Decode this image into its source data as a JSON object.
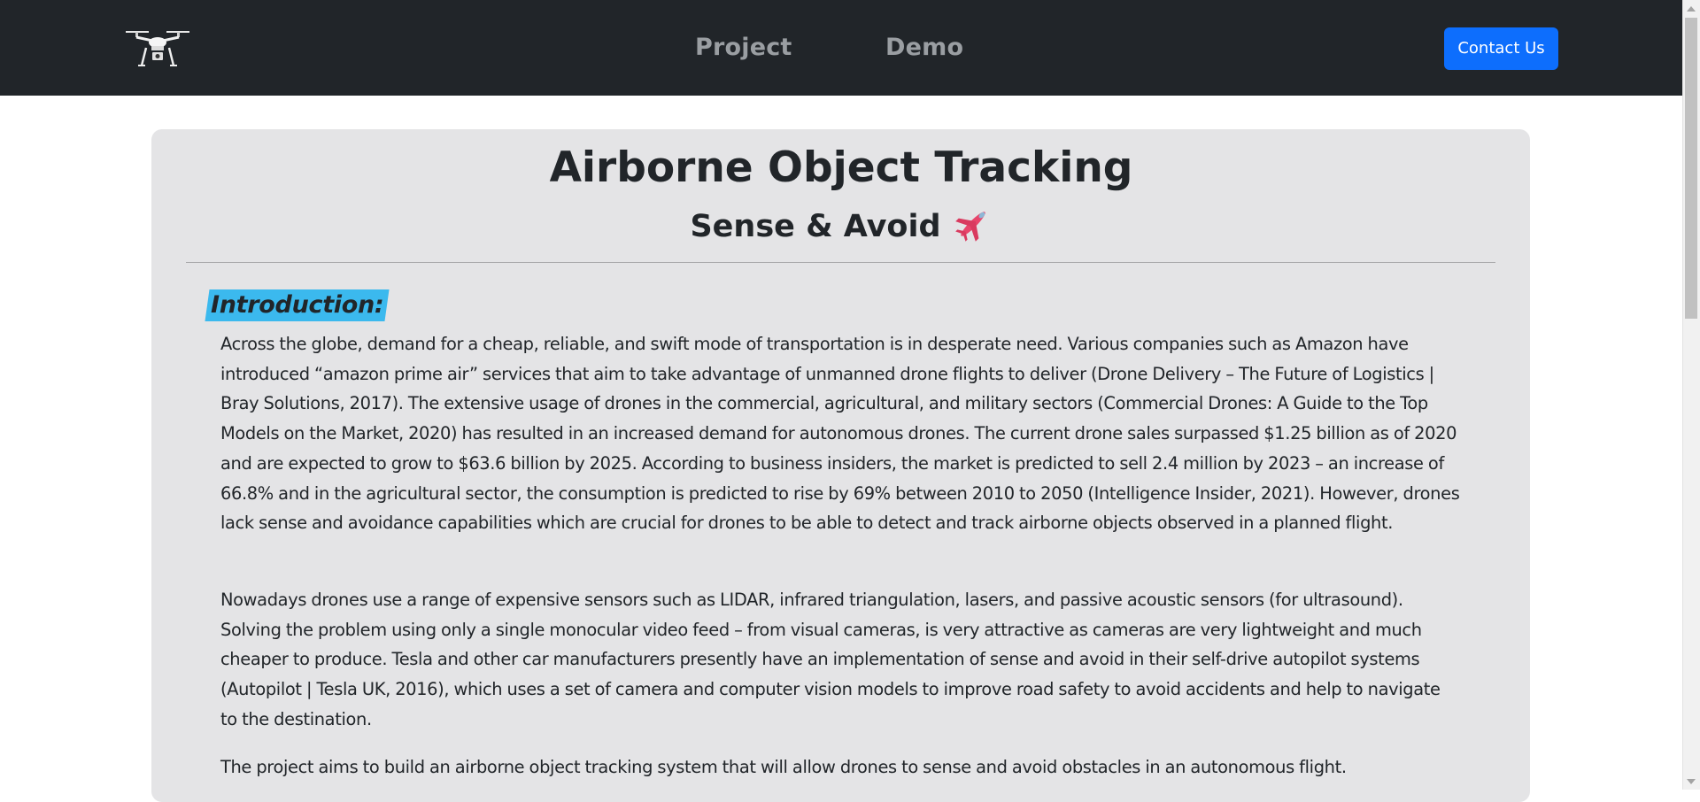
{
  "nav": {
    "logo_icon": "drone-icon",
    "links": [
      "Project",
      "Demo"
    ],
    "contact_label": "Contact Us",
    "contact_color": "#0d6efd",
    "bar_color": "#212529"
  },
  "header": {
    "title": "Airborne Object Tracking",
    "subtitle": "Sense & Avoid",
    "subtitle_icon": "airplane-icon"
  },
  "intro": {
    "heading": "Introduction:",
    "heading_highlight": "#3bb9ee",
    "paragraphs": [
      "Across the globe, demand for a cheap, reliable, and swift mode of transportation is in desperate need. Various companies such as Amazon have introduced “amazon prime air” services that aim to take advantage of unmanned drone flights to deliver (Drone Delivery – The Future of Logistics | Bray Solutions, 2017). The extensive usage of drones in the commercial, agricultural, and military sectors (Commercial Drones: A Guide to the Top Models on the Market, 2020) has resulted in an increased demand for autonomous drones. The current drone sales surpassed $1.25 billion as of 2020 and are expected to grow to $63.6 billion by 2025. According to business insiders, the market is predicted to sell 2.4 million by 2023 – an increase of 66.8% and in the agricultural sector, the consumption is predicted to rise by 69% between 2010 to 2050 (Intelligence Insider, 2021). However, drones lack sense and avoidance capabilities which are crucial for drones to be able to detect and track airborne objects observed in a planned flight.",
      "Nowadays drones use a range of expensive sensors such as LIDAR, infrared triangulation, lasers, and passive acoustic sensors (for ultrasound). Solving the problem using only a single monocular video feed – from visual cameras, is very attractive as cameras are very lightweight and much cheaper to produce. Tesla and other car manufacturers presently have an implementation of sense and avoid in their self-drive autopilot systems (Autopilot | Tesla UK, 2016), which uses a set of camera and computer vision models to improve road safety to avoid accidents and help to navigate to the destination.",
      "The project aims to build an airborne object tracking system that will allow drones to sense and avoid obstacles in an autonomous flight."
    ]
  }
}
